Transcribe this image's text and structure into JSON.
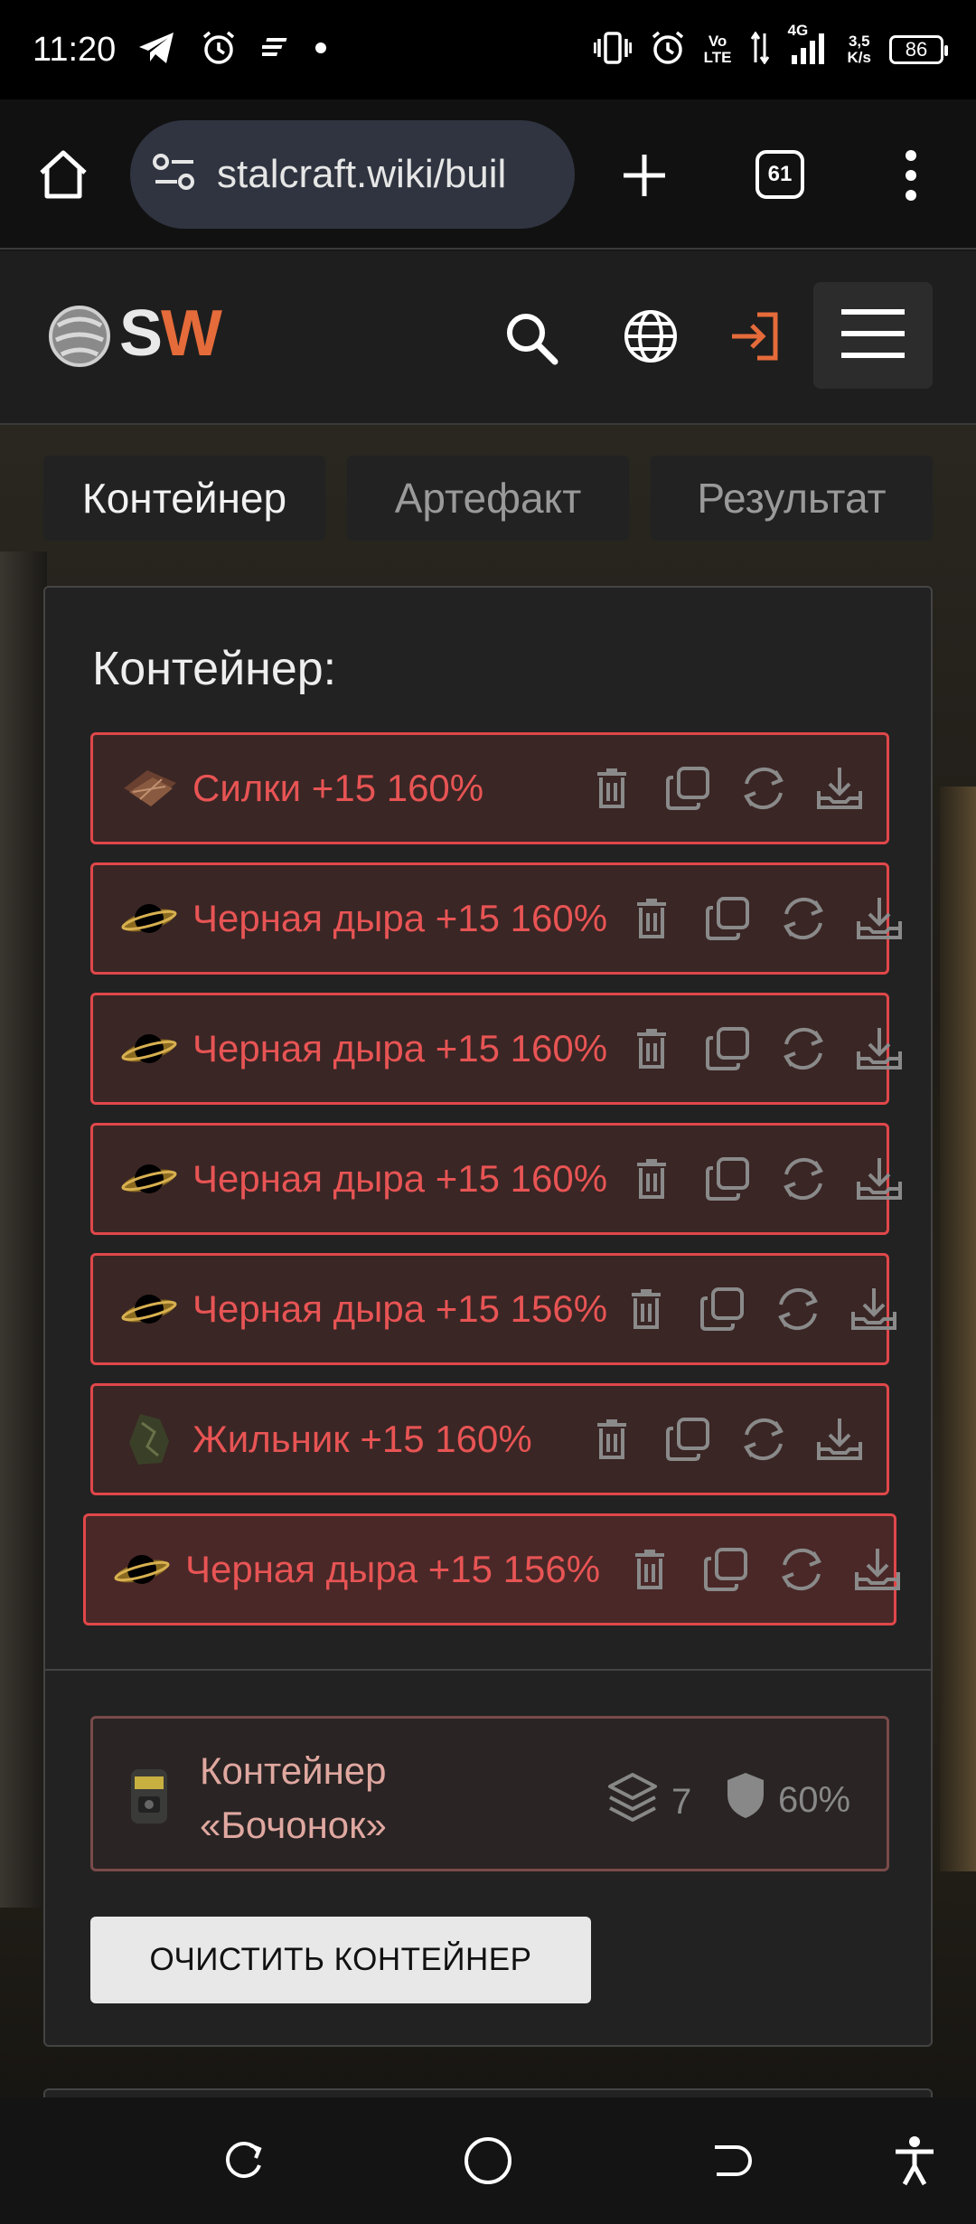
{
  "status_bar": {
    "time": "11:20",
    "network_speed_value": "3,5",
    "network_speed_unit": "K/s",
    "battery": "86",
    "volte_top": "Vo",
    "volte_bottom": "LTE",
    "signal_label": "4G"
  },
  "browser": {
    "url": "stalcraft.wiki/buil",
    "tab_count": "61"
  },
  "site": {
    "logo_s": "S",
    "logo_w": "W",
    "accent_color": "#e56b3a"
  },
  "tabs": [
    {
      "label": "Контейнер",
      "active": true
    },
    {
      "label": "Артефакт",
      "active": false
    },
    {
      "label": "Результат",
      "active": false
    }
  ],
  "panel": {
    "title": "Контейнер:",
    "items": [
      {
        "name": "Силки +15 160%",
        "icon": "snare-artifact-icon"
      },
      {
        "name": "Черная дыра +15 160%",
        "icon": "black-hole-artifact-icon"
      },
      {
        "name": "Черная дыра +15 160%",
        "icon": "black-hole-artifact-icon"
      },
      {
        "name": "Черная дыра +15 160%",
        "icon": "black-hole-artifact-icon"
      },
      {
        "name": "Черная дыра +15 156%",
        "icon": "black-hole-artifact-icon"
      },
      {
        "name": "Жильник +15 160%",
        "icon": "vein-artifact-icon"
      },
      {
        "name": "Черная дыра +15 156%",
        "icon": "black-hole-artifact-icon"
      }
    ],
    "container": {
      "name": "Контейнер «Бочонок»",
      "slots": "7",
      "protection": "60%"
    },
    "clear_button": "ОЧИСТИТЬ КОНТЕЙНЕР"
  },
  "colors": {
    "item_border": "#e0474a",
    "item_text": "#e85454",
    "item_bg": "#3a2625"
  }
}
